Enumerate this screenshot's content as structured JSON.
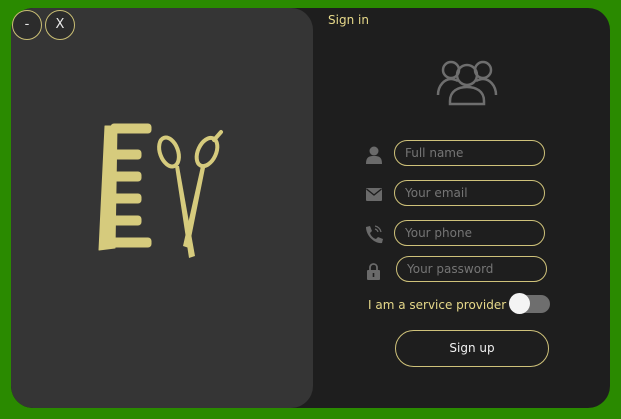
{
  "window": {
    "minimize_label": "-",
    "close_label": "X"
  },
  "header": {
    "signin_link": "Sign in"
  },
  "form": {
    "fullname": {
      "placeholder": "Full name",
      "icon": "user-icon"
    },
    "email": {
      "placeholder": "Your email",
      "icon": "mail-icon"
    },
    "phone": {
      "placeholder": "Your phone",
      "icon": "phone-icon"
    },
    "password": {
      "placeholder": "Your password",
      "icon": "lock-icon"
    },
    "provider_label": "I am a service provider",
    "provider_toggle_on": false,
    "signup_label": "Sign up"
  },
  "colors": {
    "accent": "#cfc27a",
    "background": "#1e1e1e",
    "panel": "#353535",
    "frame": "#2a8a00"
  }
}
